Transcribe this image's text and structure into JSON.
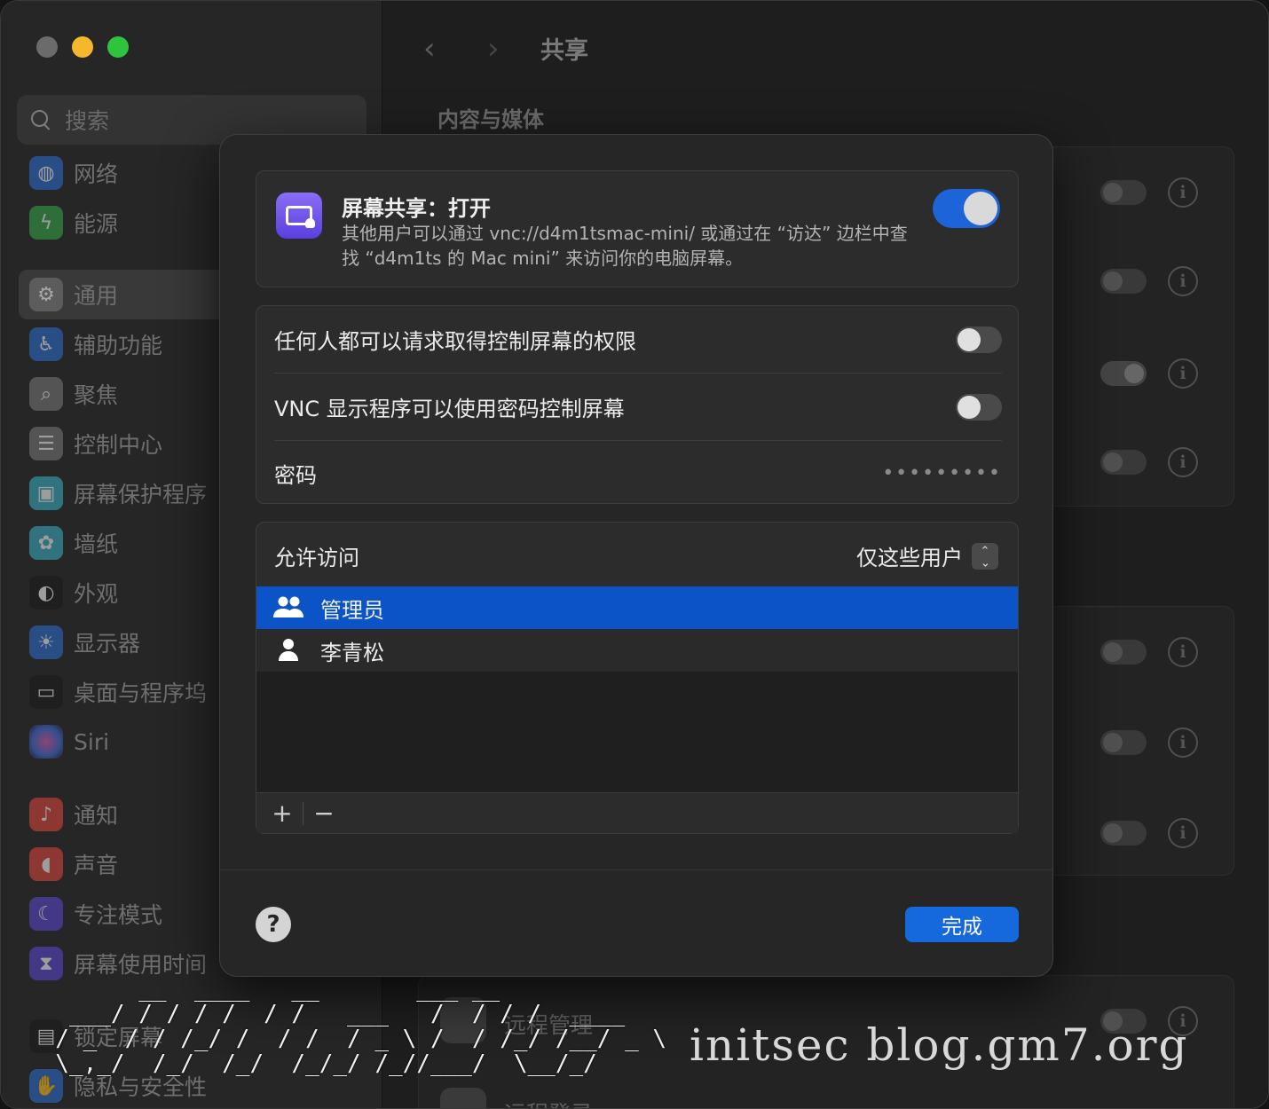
{
  "window": {
    "nav_back": "‹",
    "nav_forward": "›",
    "title": "共享",
    "section_title": "内容与媒体"
  },
  "sidebar": {
    "search_placeholder": "搜索",
    "items": [
      {
        "label": "网络",
        "icon": "globe-icon",
        "color": "#2d6fd6"
      },
      {
        "label": "能源",
        "icon": "bolt-icon",
        "color": "#34a94a"
      },
      {
        "label": "通用",
        "icon": "gear-icon",
        "color": "#7a7a7a",
        "selected": true
      },
      {
        "label": "辅助功能",
        "icon": "accessibility-icon",
        "color": "#2d6fd6"
      },
      {
        "label": "聚焦",
        "icon": "magnifier-icon",
        "color": "#7a7a7a"
      },
      {
        "label": "控制中心",
        "icon": "switches-icon",
        "color": "#7a7a7a"
      },
      {
        "label": "屏幕保护程序",
        "icon": "screensaver-icon",
        "color": "#3bb0c9"
      },
      {
        "label": "墙纸",
        "icon": "flower-icon",
        "color": "#3bb0c9"
      },
      {
        "label": "外观",
        "icon": "appearance-icon",
        "color": "#1a1a1a"
      },
      {
        "label": "显示器",
        "icon": "sun-icon",
        "color": "#2d6fd6"
      },
      {
        "label": "桌面与程序坞",
        "icon": "dock-icon",
        "color": "#1a1a1a"
      },
      {
        "label": "Siri",
        "icon": "siri-icon",
        "color": "#7b3fcf"
      },
      {
        "label": "通知",
        "icon": "bell-icon",
        "color": "#e0463d"
      },
      {
        "label": "声音",
        "icon": "speaker-icon",
        "color": "#e0463d"
      },
      {
        "label": "专注模式",
        "icon": "moon-icon",
        "color": "#5b48d6"
      },
      {
        "label": "屏幕使用时间",
        "icon": "hourglass-icon",
        "color": "#5b48d6"
      },
      {
        "label": "锁定屏幕",
        "icon": "lock-icon",
        "color": "#1a1a1a"
      },
      {
        "label": "隐私与安全性",
        "icon": "hand-icon",
        "color": "#2d6fd6"
      }
    ]
  },
  "background": {
    "remote_management": "远程管理",
    "remote_login": "远程登录",
    "info_glyph": "i"
  },
  "sheet": {
    "screen_sharing": {
      "title": "屏幕共享：打开",
      "description": "其他用户可以通过 vnc://d4m1tsmac-mini/ 或通过在 “访达” 边栏中查找 “d4m1ts 的 Mac mini” 来访问你的电脑屏幕。",
      "enabled": true
    },
    "options": {
      "anyone_request": "任何人都可以请求取得控制屏幕的权限",
      "vnc_password": "VNC 显示程序可以使用密码控制屏幕",
      "password_label": "密码",
      "password_mask": "•••••••••"
    },
    "access": {
      "label": "允许访问",
      "selected_option": "仅这些用户",
      "users": [
        {
          "name": "管理员",
          "icon": "group-icon",
          "selected": true
        },
        {
          "name": "李青松",
          "icon": "person-icon",
          "selected": false
        }
      ],
      "add": "+",
      "remove": "−"
    },
    "help": "?",
    "done": "完成"
  },
  "watermark": {
    "text": "initsec blog.gm7.org"
  },
  "colors": {
    "accent": "#1668dd",
    "selection": "#0b54c7",
    "toggle_on": "#1d64d8"
  }
}
